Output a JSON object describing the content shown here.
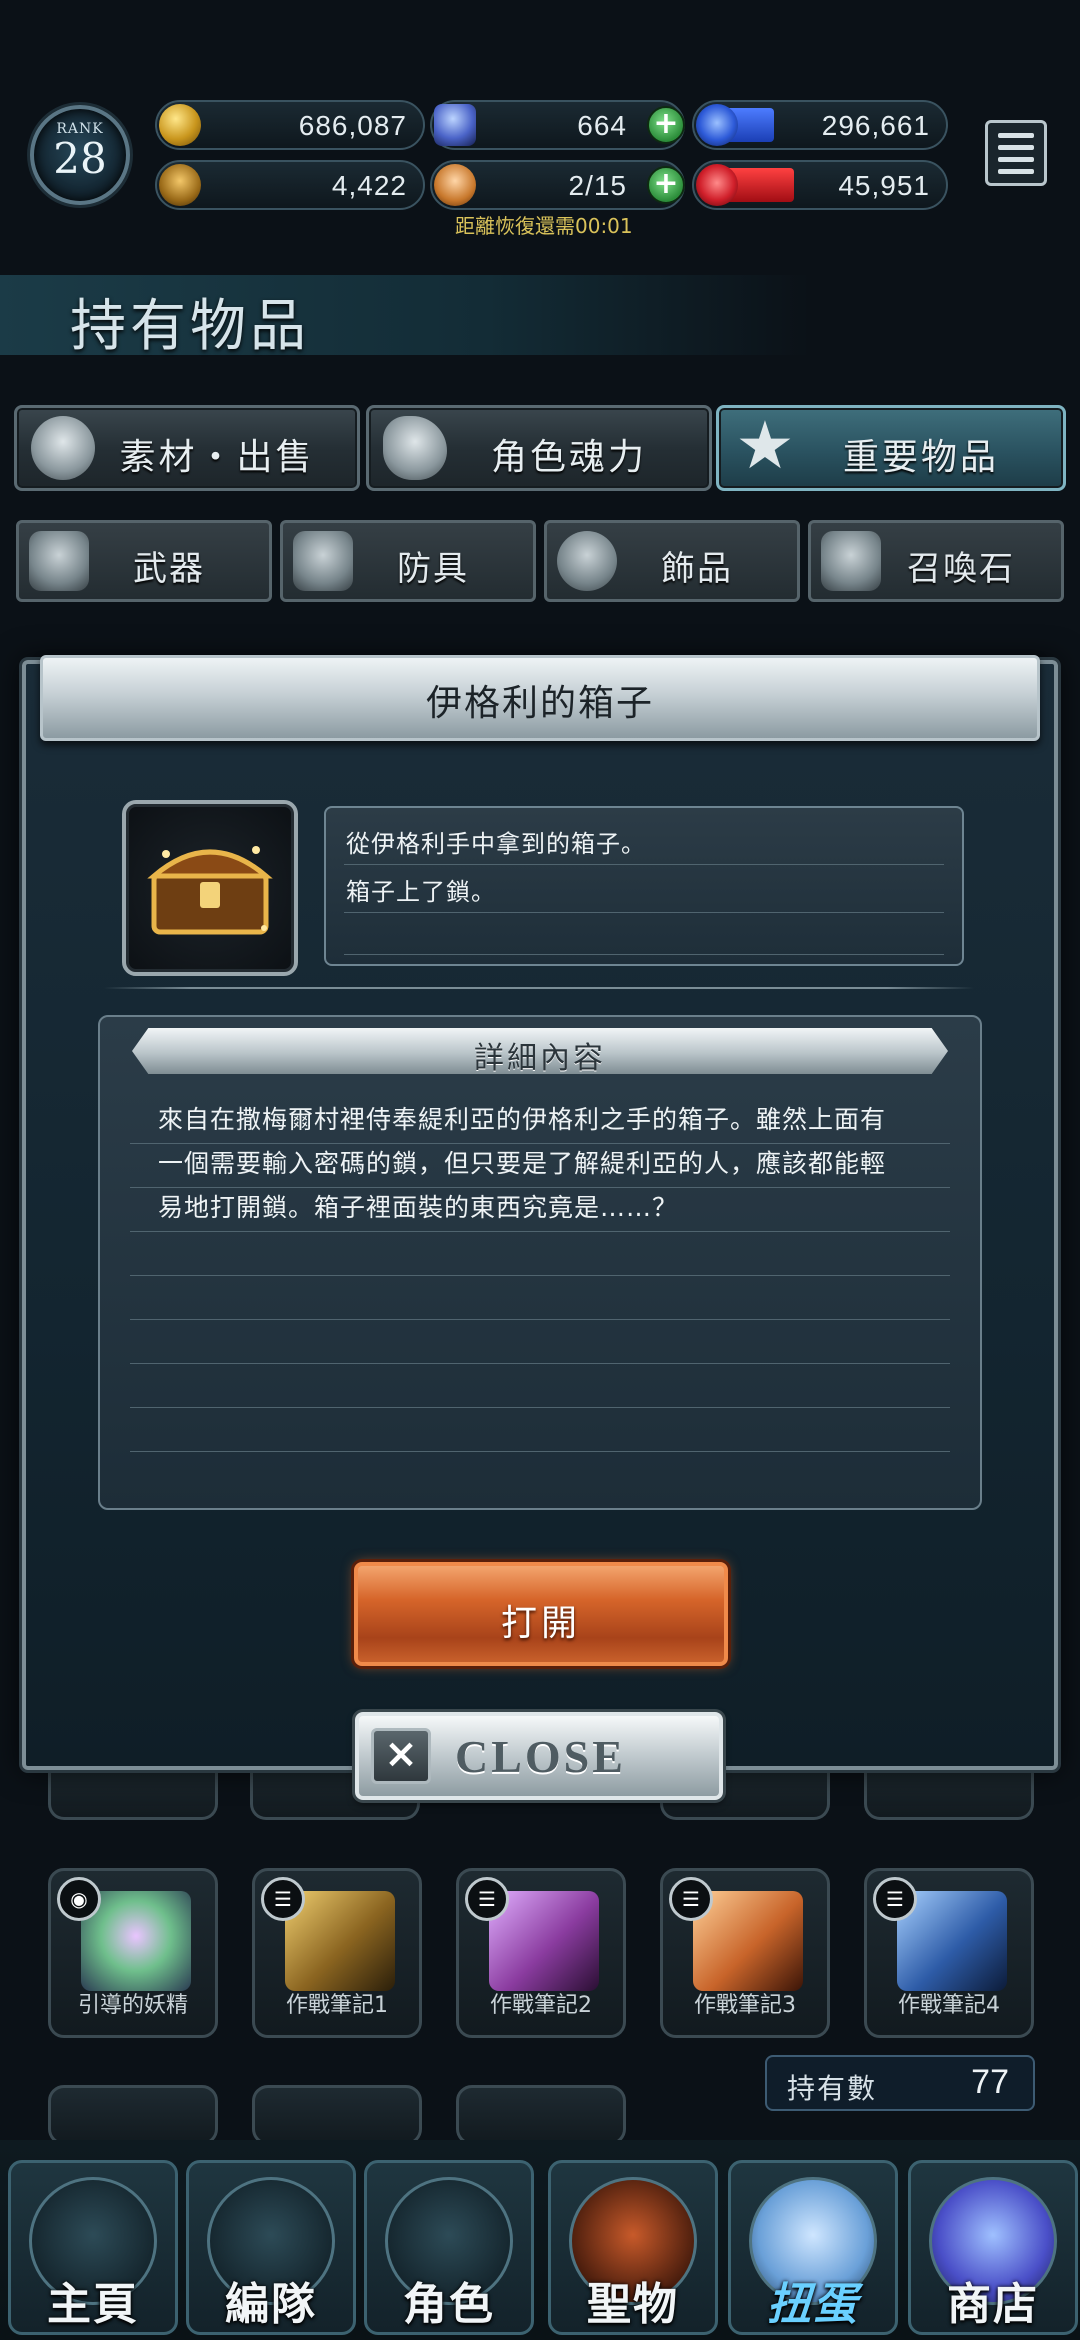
{
  "rank": {
    "label": "RANK",
    "value": "28"
  },
  "resources": {
    "gold": "686,087",
    "crystal": "664",
    "blue_gauge": "296,661",
    "trophy": "4,422",
    "stamina": "2/15",
    "red_gauge": "45,951",
    "recovery_timer": "距離恢復還需00:01"
  },
  "header": {
    "title": "持有物品"
  },
  "tabs": [
    {
      "label": "素材・出售",
      "icon": "bag-icon"
    },
    {
      "label": "角色魂力",
      "icon": "soul-flame-icon"
    },
    {
      "label": "重要物品",
      "icon": "star-icon"
    }
  ],
  "subtabs": [
    {
      "label": "武器",
      "icon": "sword-icon"
    },
    {
      "label": "防具",
      "icon": "armor-icon"
    },
    {
      "label": "飾品",
      "icon": "ring-icon"
    },
    {
      "label": "召喚石",
      "icon": "summon-stone-icon"
    }
  ],
  "background_items": [
    {
      "label": "引導的妖精"
    },
    {
      "label": "作戰筆記1"
    },
    {
      "label": "作戰筆記2"
    },
    {
      "label": "作戰筆記3"
    },
    {
      "label": "作戰筆記4"
    }
  ],
  "count": {
    "label": "持有數",
    "value": "77"
  },
  "modal": {
    "title": "伊格利的箱子",
    "short_desc": [
      "從伊格利手中拿到的箱子。",
      "箱子上了鎖。"
    ],
    "detail_header": "詳細內容",
    "detail_lines": [
      "來自在撒梅爾村裡侍奉緹利亞的伊格利之手的箱子。雖然上面有",
      "一個需要輸入密碼的鎖，但只要是了解緹利亞的人，應該都能輕",
      "易地打開鎖。箱子裡面裝的東西究竟是……？"
    ],
    "open_button": "打開",
    "close_button": "CLOSE"
  },
  "nav": [
    {
      "label": "主頁"
    },
    {
      "label": "編隊"
    },
    {
      "label": "角色"
    },
    {
      "label": "聖物"
    },
    {
      "label": "扭蛋"
    },
    {
      "label": "商店"
    }
  ],
  "colors": {
    "accent_tab": "#3f6f7c",
    "open_button": "#d6652a",
    "timer_text": "#d9c25a"
  }
}
